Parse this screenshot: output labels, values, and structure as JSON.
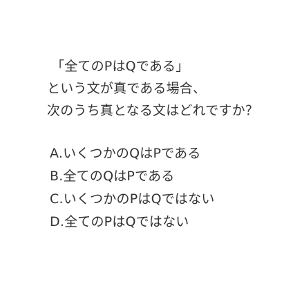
{
  "question": {
    "premise": "「全てのPはQである」",
    "line2": "という文が真である場合、",
    "line3": "次のうち真となる文はどれですか？"
  },
  "choices": [
    {
      "label": "A.いくつかのQはPである"
    },
    {
      "label": "B.全てのQはPである"
    },
    {
      "label": "C.いくつかのPはQではない"
    },
    {
      "label": "D.全てのPはQではない"
    }
  ],
  "colors": {
    "background": "#ffffff",
    "text": "#333333"
  }
}
